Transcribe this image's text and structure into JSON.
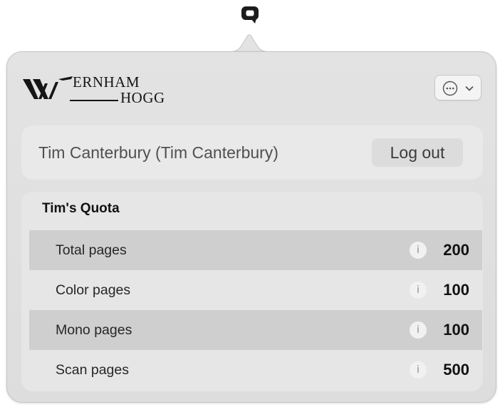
{
  "menubar": {
    "icon": "q-icon"
  },
  "logo": {
    "line1": "ERNHAM",
    "line2": "HOGG"
  },
  "more_menu": {
    "icon": "ellipsis-circle-icon",
    "chevron": "chevron-down-icon"
  },
  "user": {
    "name": "Tim Canterbury (Tim Canterbury)",
    "logout_label": "Log out"
  },
  "quota": {
    "title": "Tim's Quota",
    "info_glyph": "i",
    "rows": [
      {
        "label": "Total pages",
        "value": "200"
      },
      {
        "label": "Color pages",
        "value": "100"
      },
      {
        "label": "Mono pages",
        "value": "100"
      },
      {
        "label": "Scan pages",
        "value": "500"
      }
    ]
  },
  "colors": {
    "panel_bg": "#e0e0e0",
    "card_bg": "#e9e9e9",
    "row_shade": "#cfcfcf",
    "text_primary": "#111111"
  }
}
